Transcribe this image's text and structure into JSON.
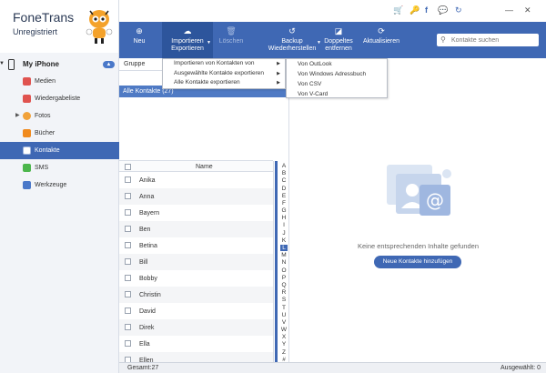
{
  "app": {
    "name": "FoneTrans",
    "status": "Unregistriert"
  },
  "titlebar_icons": [
    "cart-icon",
    "key-icon",
    "facebook-icon",
    "chat-icon",
    "refresh-icon",
    "minimize-icon",
    "close-icon"
  ],
  "device": {
    "name": "My iPhone"
  },
  "sidebar": {
    "items": [
      {
        "label": "Medien",
        "icon": "music-icon",
        "color": "#e0534f"
      },
      {
        "label": "Wiedergabeliste",
        "icon": "playlist-icon",
        "color": "#e0534f"
      },
      {
        "label": "Fotos",
        "icon": "photos-icon",
        "color": "#f1a23a"
      },
      {
        "label": "Bücher",
        "icon": "books-icon",
        "color": "#f08a1d"
      },
      {
        "label": "Kontakte",
        "icon": "contacts-icon",
        "color": "#6e8fc9"
      },
      {
        "label": "SMS",
        "icon": "sms-icon",
        "color": "#4cb64c"
      },
      {
        "label": "Werkzeuge",
        "icon": "tools-icon",
        "color": "#4a78c9"
      }
    ]
  },
  "toolbar": {
    "new": "Neu",
    "import_export_1": "Importieren",
    "import_export_2": "Exportieren",
    "delete": "Löschen",
    "backup_1": "Backup",
    "backup_2": "Wiederherstellen",
    "dedupe_1": "Doppeltes",
    "dedupe_2": "entfernen",
    "refresh": "Aktualisieren",
    "search_placeholder": "Kontakte suchen"
  },
  "group": {
    "label": "Gruppe"
  },
  "all_contacts": {
    "label": "Alle Kontakte  (27)"
  },
  "menu_main": [
    "Importieren von Kontakten von",
    "Ausgewählte Kontakte exportieren",
    "Alle Kontakte exportieren"
  ],
  "menu_sub": [
    "Von OutLook",
    "Von Windows Adressbuch",
    "Von CSV",
    "Von V-Card"
  ],
  "list": {
    "header": "Name",
    "rows": [
      "Anika",
      "Anna",
      "Bayern",
      "Ben",
      "Betina",
      "Bill",
      "Bobby",
      "Christin",
      "David",
      "Direk",
      "Ella",
      "Ellen"
    ]
  },
  "alphabet": [
    "A",
    "B",
    "C",
    "D",
    "E",
    "F",
    "G",
    "H",
    "I",
    "J",
    "K",
    "L",
    "M",
    "N",
    "O",
    "P",
    "Q",
    "R",
    "S",
    "T",
    "U",
    "V",
    "W",
    "X",
    "Y",
    "Z",
    "#"
  ],
  "alphabet_selected": "L",
  "empty": {
    "message": "Keine entsprechenden Inhalte gefunden",
    "button": "Neue Kontakte hinzufügen"
  },
  "status": {
    "total": "Gesamt:27",
    "selected": "Ausgewählt: 0"
  },
  "colors": {
    "accent": "#3f68b4",
    "sidebar_bg": "#f2f4f8"
  }
}
